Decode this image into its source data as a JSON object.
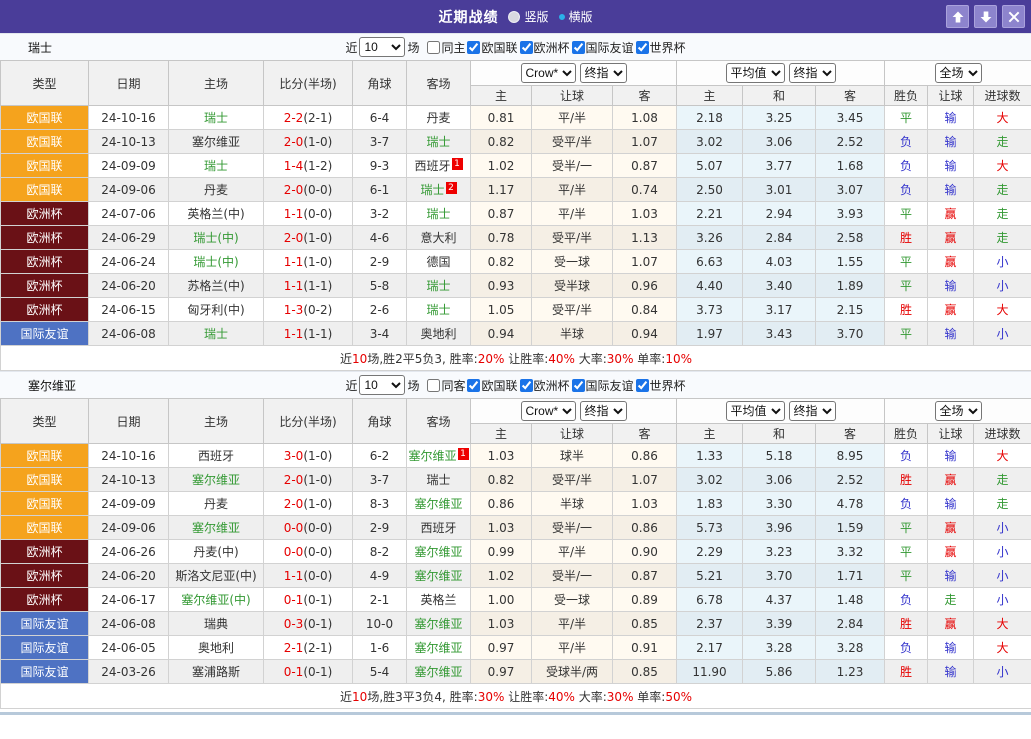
{
  "titlebar": {
    "title": "近期战绩",
    "layout_options": [
      {
        "label": "竖版",
        "selected": true
      },
      {
        "label": "横版",
        "selected": false
      }
    ],
    "window_buttons": {
      "up": "move-up",
      "down": "move-down",
      "close": "close"
    }
  },
  "colors": {
    "titlebar_bg": "#4a3d99",
    "result_map": {
      "胜": "#e60000",
      "赢": "#e60000",
      "大": "#e60000",
      "平": "#339933",
      "走": "#339933",
      "负": "#3333cc",
      "输": "#3333cc",
      "小": "#3333cc"
    },
    "type_map": {
      "欧国联": "#f5a31d",
      "欧洲杯": "#6a1116",
      "国际友谊": "#4e72c3"
    },
    "team_highlight": "#339933",
    "score_red": "#e60000"
  },
  "table_headers": {
    "static": [
      "类型",
      "日期",
      "主场",
      "比分(半场)",
      "角球",
      "客场"
    ],
    "group1": {
      "selects": [
        "Crow*",
        "终指"
      ],
      "cols": [
        "主",
        "让球",
        "客"
      ]
    },
    "group2": {
      "selects": [
        "平均值",
        "终指"
      ],
      "cols": [
        "主",
        "和",
        "客"
      ]
    },
    "group3": {
      "selects": [
        "全场"
      ],
      "cols": [
        "胜负",
        "让球",
        "进球数"
      ]
    }
  },
  "sections": [
    {
      "team": "瑞士",
      "filter": {
        "prefix": "近",
        "count": "10",
        "suffix": "场",
        "same_label": "同主",
        "same_checked": false,
        "competitions": [
          {
            "label": "欧国联",
            "checked": true
          },
          {
            "label": "欧洲杯",
            "checked": true
          },
          {
            "label": "国际友谊",
            "checked": true
          },
          {
            "label": "世界杯",
            "checked": true
          }
        ]
      },
      "rows": [
        {
          "type": "欧国联",
          "date": "24-10-16",
          "home": "瑞士",
          "home_green": true,
          "home_sup": "",
          "score": "2-2",
          "half": "(2-1)",
          "corner": "6-4",
          "away": "丹麦",
          "away_green": false,
          "away_sup": "",
          "crow": [
            "0.81",
            "平/半",
            "1.08"
          ],
          "avg": [
            "2.18",
            "3.25",
            "3.45"
          ],
          "full": [
            "平",
            "输",
            "大"
          ]
        },
        {
          "type": "欧国联",
          "date": "24-10-13",
          "home": "塞尔维亚",
          "home_green": false,
          "home_sup": "",
          "score": "2-0",
          "half": "(1-0)",
          "corner": "3-7",
          "away": "瑞士",
          "away_green": true,
          "away_sup": "",
          "crow": [
            "0.82",
            "受平/半",
            "1.07"
          ],
          "avg": [
            "3.02",
            "3.06",
            "2.52"
          ],
          "full": [
            "负",
            "输",
            "走"
          ]
        },
        {
          "type": "欧国联",
          "date": "24-09-09",
          "home": "瑞士",
          "home_green": true,
          "home_sup": "",
          "score": "1-4",
          "half": "(1-2)",
          "corner": "9-3",
          "away": "西班牙",
          "away_green": false,
          "away_sup": "1",
          "crow": [
            "1.02",
            "受半/一",
            "0.87"
          ],
          "avg": [
            "5.07",
            "3.77",
            "1.68"
          ],
          "full": [
            "负",
            "输",
            "大"
          ]
        },
        {
          "type": "欧国联",
          "date": "24-09-06",
          "home": "丹麦",
          "home_green": false,
          "home_sup": "",
          "score": "2-0",
          "half": "(0-0)",
          "corner": "6-1",
          "away": "瑞士",
          "away_green": true,
          "away_sup": "2",
          "crow": [
            "1.17",
            "平/半",
            "0.74"
          ],
          "avg": [
            "2.50",
            "3.01",
            "3.07"
          ],
          "full": [
            "负",
            "输",
            "走"
          ]
        },
        {
          "type": "欧洲杯",
          "date": "24-07-06",
          "home": "英格兰(中)",
          "home_green": false,
          "home_sup": "",
          "score": "1-1",
          "half": "(0-0)",
          "corner": "3-2",
          "away": "瑞士",
          "away_green": true,
          "away_sup": "",
          "crow": [
            "0.87",
            "平/半",
            "1.03"
          ],
          "avg": [
            "2.21",
            "2.94",
            "3.93"
          ],
          "full": [
            "平",
            "赢",
            "走"
          ]
        },
        {
          "type": "欧洲杯",
          "date": "24-06-29",
          "home": "瑞士(中)",
          "home_green": true,
          "home_sup": "",
          "score": "2-0",
          "half": "(1-0)",
          "corner": "4-6",
          "away": "意大利",
          "away_green": false,
          "away_sup": "",
          "crow": [
            "0.78",
            "受平/半",
            "1.13"
          ],
          "avg": [
            "3.26",
            "2.84",
            "2.58"
          ],
          "full": [
            "胜",
            "赢",
            "走"
          ]
        },
        {
          "type": "欧洲杯",
          "date": "24-06-24",
          "home": "瑞士(中)",
          "home_green": true,
          "home_sup": "",
          "score": "1-1",
          "half": "(1-0)",
          "corner": "2-9",
          "away": "德国",
          "away_green": false,
          "away_sup": "",
          "crow": [
            "0.82",
            "受一球",
            "1.07"
          ],
          "avg": [
            "6.63",
            "4.03",
            "1.55"
          ],
          "full": [
            "平",
            "赢",
            "小"
          ]
        },
        {
          "type": "欧洲杯",
          "date": "24-06-20",
          "home": "苏格兰(中)",
          "home_green": false,
          "home_sup": "",
          "score": "1-1",
          "half": "(1-1)",
          "corner": "5-8",
          "away": "瑞士",
          "away_green": true,
          "away_sup": "",
          "crow": [
            "0.93",
            "受半球",
            "0.96"
          ],
          "avg": [
            "4.40",
            "3.40",
            "1.89"
          ],
          "full": [
            "平",
            "输",
            "小"
          ]
        },
        {
          "type": "欧洲杯",
          "date": "24-06-15",
          "home": "匈牙利(中)",
          "home_green": false,
          "home_sup": "",
          "score": "1-3",
          "half": "(0-2)",
          "corner": "2-6",
          "away": "瑞士",
          "away_green": true,
          "away_sup": "",
          "crow": [
            "1.05",
            "受平/半",
            "0.84"
          ],
          "avg": [
            "3.73",
            "3.17",
            "2.15"
          ],
          "full": [
            "胜",
            "赢",
            "大"
          ]
        },
        {
          "type": "国际友谊",
          "date": "24-06-08",
          "home": "瑞士",
          "home_green": true,
          "home_sup": "",
          "score": "1-1",
          "half": "(1-1)",
          "corner": "3-4",
          "away": "奥地利",
          "away_green": false,
          "away_sup": "",
          "crow": [
            "0.94",
            "半球",
            "0.94"
          ],
          "avg": [
            "1.97",
            "3.43",
            "3.70"
          ],
          "full": [
            "平",
            "输",
            "小"
          ]
        }
      ],
      "summary": [
        {
          "t": "近"
        },
        {
          "t": "10",
          "red": true
        },
        {
          "t": "场,胜2平5负3, 胜率:"
        },
        {
          "t": "20%",
          "red": true
        },
        {
          "t": " 让胜率:"
        },
        {
          "t": "40%",
          "red": true
        },
        {
          "t": " 大率:"
        },
        {
          "t": "30%",
          "red": true
        },
        {
          "t": " 单率:"
        },
        {
          "t": "10%",
          "red": true
        }
      ]
    },
    {
      "team": "塞尔维亚",
      "filter": {
        "prefix": "近",
        "count": "10",
        "suffix": "场",
        "same_label": "同客",
        "same_checked": false,
        "competitions": [
          {
            "label": "欧国联",
            "checked": true
          },
          {
            "label": "欧洲杯",
            "checked": true
          },
          {
            "label": "国际友谊",
            "checked": true
          },
          {
            "label": "世界杯",
            "checked": true
          }
        ]
      },
      "rows": [
        {
          "type": "欧国联",
          "date": "24-10-16",
          "home": "西班牙",
          "home_green": false,
          "home_sup": "",
          "score": "3-0",
          "half": "(1-0)",
          "corner": "6-2",
          "away": "塞尔维亚",
          "away_green": true,
          "away_sup": "1",
          "crow": [
            "1.03",
            "球半",
            "0.86"
          ],
          "avg": [
            "1.33",
            "5.18",
            "8.95"
          ],
          "full": [
            "负",
            "输",
            "大"
          ]
        },
        {
          "type": "欧国联",
          "date": "24-10-13",
          "home": "塞尔维亚",
          "home_green": true,
          "home_sup": "",
          "score": "2-0",
          "half": "(1-0)",
          "corner": "3-7",
          "away": "瑞士",
          "away_green": false,
          "away_sup": "",
          "crow": [
            "0.82",
            "受平/半",
            "1.07"
          ],
          "avg": [
            "3.02",
            "3.06",
            "2.52"
          ],
          "full": [
            "胜",
            "赢",
            "走"
          ]
        },
        {
          "type": "欧国联",
          "date": "24-09-09",
          "home": "丹麦",
          "home_green": false,
          "home_sup": "",
          "score": "2-0",
          "half": "(1-0)",
          "corner": "8-3",
          "away": "塞尔维亚",
          "away_green": true,
          "away_sup": "",
          "crow": [
            "0.86",
            "半球",
            "1.03"
          ],
          "avg": [
            "1.83",
            "3.30",
            "4.78"
          ],
          "full": [
            "负",
            "输",
            "走"
          ]
        },
        {
          "type": "欧国联",
          "date": "24-09-06",
          "home": "塞尔维亚",
          "home_green": true,
          "home_sup": "",
          "score": "0-0",
          "half": "(0-0)",
          "corner": "2-9",
          "away": "西班牙",
          "away_green": false,
          "away_sup": "",
          "crow": [
            "1.03",
            "受半/一",
            "0.86"
          ],
          "avg": [
            "5.73",
            "3.96",
            "1.59"
          ],
          "full": [
            "平",
            "赢",
            "小"
          ]
        },
        {
          "type": "欧洲杯",
          "date": "24-06-26",
          "home": "丹麦(中)",
          "home_green": false,
          "home_sup": "",
          "score": "0-0",
          "half": "(0-0)",
          "corner": "8-2",
          "away": "塞尔维亚",
          "away_green": true,
          "away_sup": "",
          "crow": [
            "0.99",
            "平/半",
            "0.90"
          ],
          "avg": [
            "2.29",
            "3.23",
            "3.32"
          ],
          "full": [
            "平",
            "赢",
            "小"
          ]
        },
        {
          "type": "欧洲杯",
          "date": "24-06-20",
          "home": "斯洛文尼亚(中)",
          "home_green": false,
          "home_sup": "",
          "score": "1-1",
          "half": "(0-0)",
          "corner": "4-9",
          "away": "塞尔维亚",
          "away_green": true,
          "away_sup": "",
          "crow": [
            "1.02",
            "受半/一",
            "0.87"
          ],
          "avg": [
            "5.21",
            "3.70",
            "1.71"
          ],
          "full": [
            "平",
            "输",
            "小"
          ]
        },
        {
          "type": "欧洲杯",
          "date": "24-06-17",
          "home": "塞尔维亚(中)",
          "home_green": true,
          "home_sup": "",
          "score": "0-1",
          "half": "(0-1)",
          "corner": "2-1",
          "away": "英格兰",
          "away_green": false,
          "away_sup": "",
          "crow": [
            "1.00",
            "受一球",
            "0.89"
          ],
          "avg": [
            "6.78",
            "4.37",
            "1.48"
          ],
          "full": [
            "负",
            "走",
            "小"
          ]
        },
        {
          "type": "国际友谊",
          "date": "24-06-08",
          "home": "瑞典",
          "home_green": false,
          "home_sup": "",
          "score": "0-3",
          "half": "(0-1)",
          "corner": "10-0",
          "away": "塞尔维亚",
          "away_green": true,
          "away_sup": "",
          "crow": [
            "1.03",
            "平/半",
            "0.85"
          ],
          "avg": [
            "2.37",
            "3.39",
            "2.84"
          ],
          "full": [
            "胜",
            "赢",
            "大"
          ]
        },
        {
          "type": "国际友谊",
          "date": "24-06-05",
          "home": "奥地利",
          "home_green": false,
          "home_sup": "",
          "score": "2-1",
          "half": "(2-1)",
          "corner": "1-6",
          "away": "塞尔维亚",
          "away_green": true,
          "away_sup": "",
          "crow": [
            "0.97",
            "平/半",
            "0.91"
          ],
          "avg": [
            "2.17",
            "3.28",
            "3.28"
          ],
          "full": [
            "负",
            "输",
            "大"
          ]
        },
        {
          "type": "国际友谊",
          "date": "24-03-26",
          "home": "塞浦路斯",
          "home_green": false,
          "home_sup": "",
          "score": "0-1",
          "half": "(0-1)",
          "corner": "5-4",
          "away": "塞尔维亚",
          "away_green": true,
          "away_sup": "",
          "crow": [
            "0.97",
            "受球半/两",
            "0.85"
          ],
          "avg": [
            "11.90",
            "5.86",
            "1.23"
          ],
          "full": [
            "胜",
            "输",
            "小"
          ]
        }
      ],
      "summary": [
        {
          "t": "近"
        },
        {
          "t": "10",
          "red": true
        },
        {
          "t": "场,胜3平3负4, 胜率:"
        },
        {
          "t": "30%",
          "red": true
        },
        {
          "t": " 让胜率:"
        },
        {
          "t": "40%",
          "red": true
        },
        {
          "t": " 大率:"
        },
        {
          "t": "30%",
          "red": true
        },
        {
          "t": " 单率:"
        },
        {
          "t": "50%",
          "red": true
        }
      ]
    }
  ]
}
